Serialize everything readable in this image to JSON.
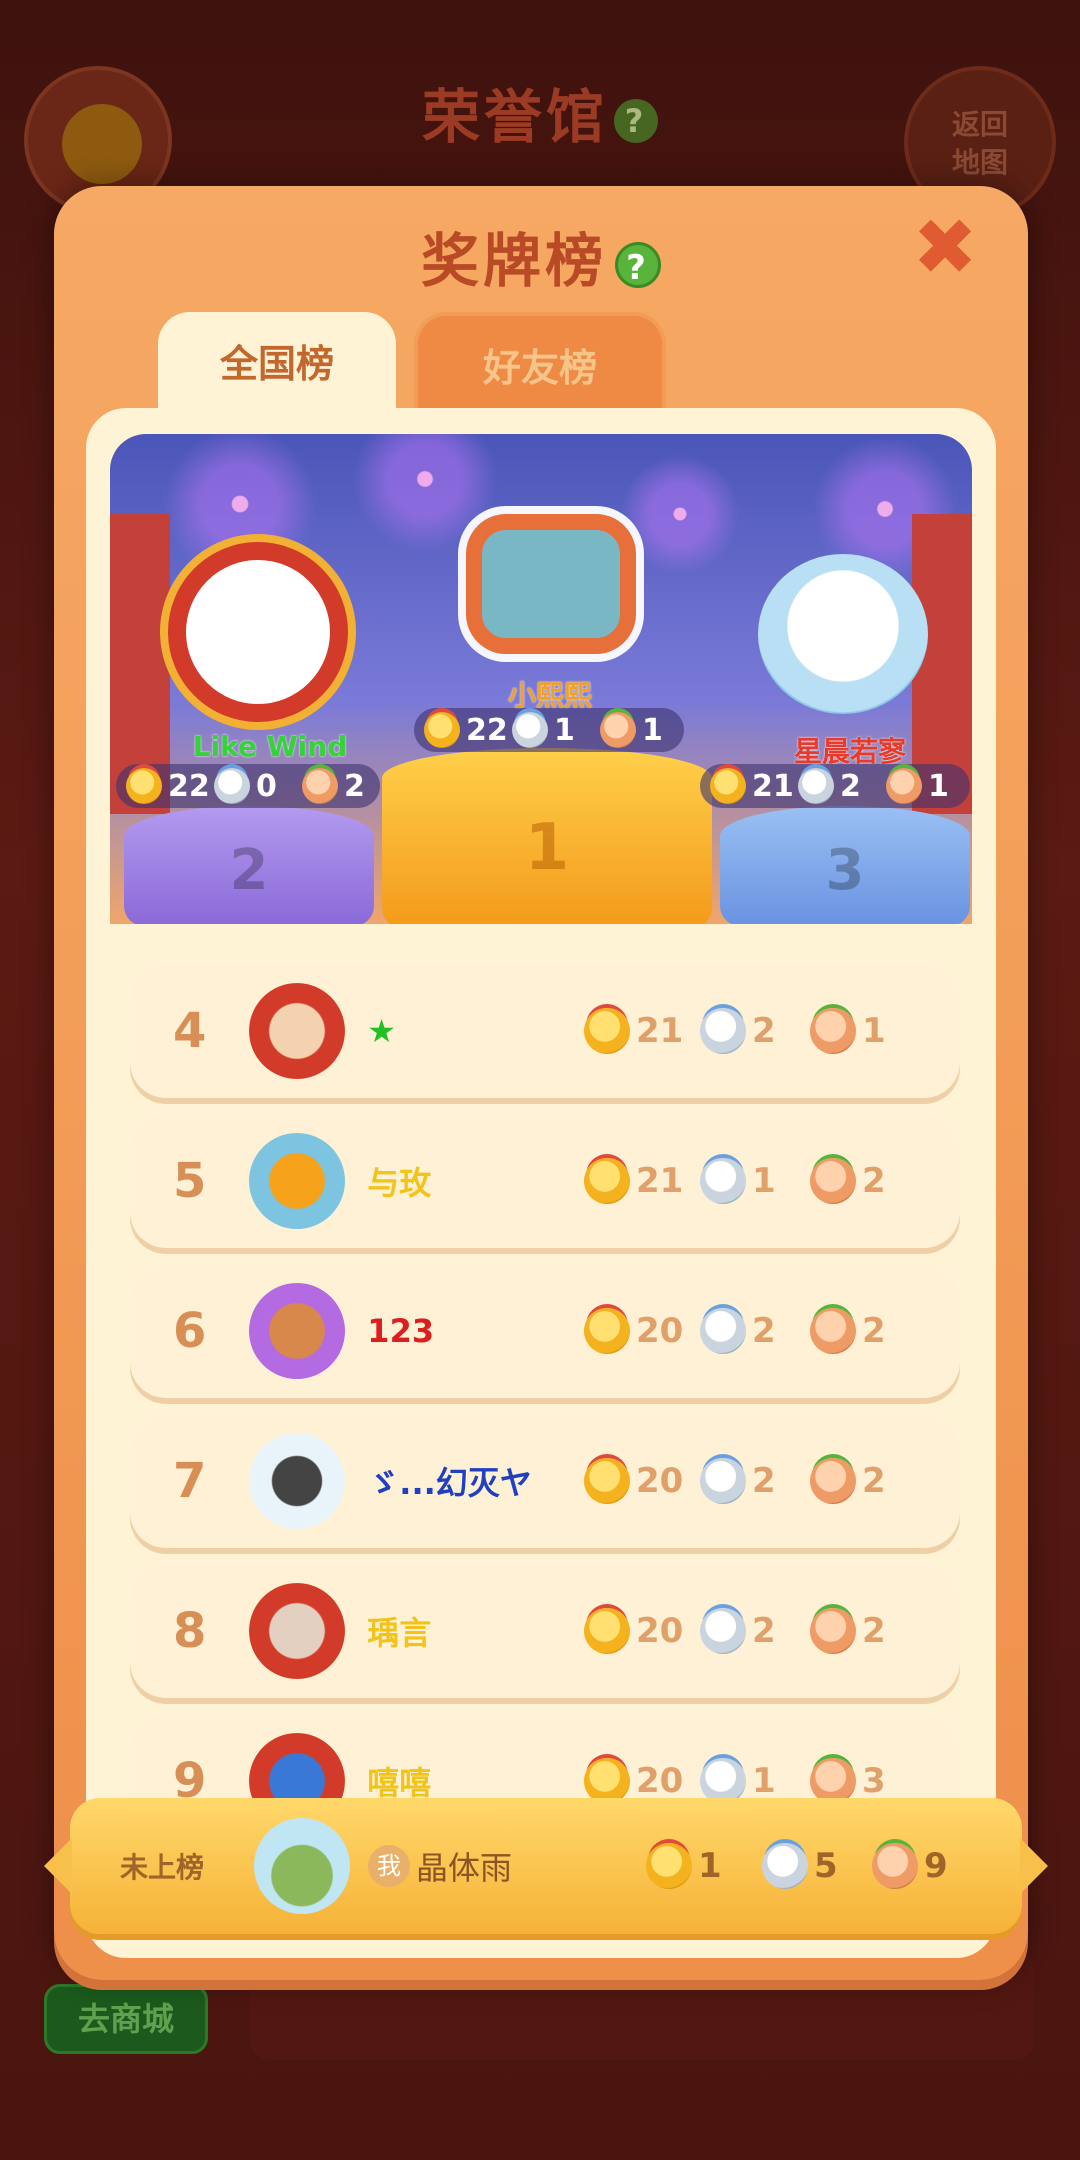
{
  "background": {
    "title": "荣誉馆",
    "return_button": "返回\n地图",
    "shop_button": "去商城"
  },
  "modal": {
    "title": "奖牌榜",
    "tabs": [
      {
        "label": "全国榜",
        "active": true
      },
      {
        "label": "好友榜",
        "active": false
      }
    ]
  },
  "podium": [
    {
      "rank": "2",
      "name": "Like Wind",
      "gold": "22",
      "silver": "0",
      "bronze": "2"
    },
    {
      "rank": "1",
      "name": "小熙熙",
      "gold": "22",
      "silver": "1",
      "bronze": "1"
    },
    {
      "rank": "3",
      "name": "星晨若寥",
      "gold": "21",
      "silver": "2",
      "bronze": "1"
    }
  ],
  "rows": [
    {
      "rank": "4",
      "name": "★",
      "name_color": "#22c022",
      "gold": "21",
      "silver": "2",
      "bronze": "1"
    },
    {
      "rank": "5",
      "name": "与玫",
      "name_color": "#f2c41a",
      "gold": "21",
      "silver": "1",
      "bronze": "2"
    },
    {
      "rank": "6",
      "name": "123",
      "name_color": "#d82020",
      "gold": "20",
      "silver": "2",
      "bronze": "2"
    },
    {
      "rank": "7",
      "name": "ゞ...幻灭ヤ",
      "name_color": "#2040c0",
      "gold": "20",
      "silver": "2",
      "bronze": "2"
    },
    {
      "rank": "8",
      "name": "瑀言",
      "name_color": "#f2c41a",
      "gold": "20",
      "silver": "2",
      "bronze": "2"
    },
    {
      "rank": "9",
      "name": "嘻嘻",
      "name_color": "#f2c41a",
      "gold": "20",
      "silver": "1",
      "bronze": "3"
    }
  ],
  "me": {
    "label": "未上榜",
    "tag": "我",
    "name": "晶体雨",
    "gold": "1",
    "silver": "5",
    "bronze": "9"
  },
  "icons": {
    "help": "?",
    "close": "✖"
  }
}
